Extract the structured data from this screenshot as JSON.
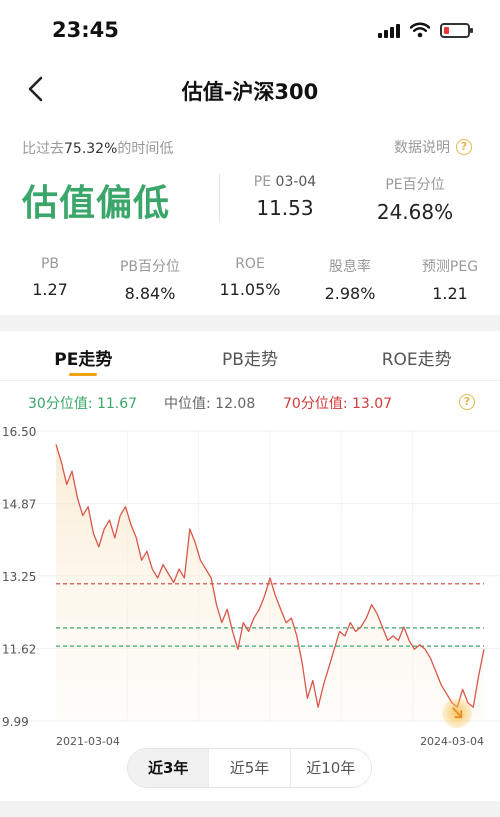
{
  "status_bar": {
    "time": "23:45"
  },
  "nav": {
    "title": "估值-沪深300"
  },
  "summary": {
    "compare_prefix": "比过去",
    "compare_value": "75.32%",
    "compare_suffix": "的时间低",
    "data_explain": "数据说明",
    "valuation_status": "估值偏低",
    "pe_label": "PE",
    "pe_date": "03-04",
    "pe_value": "11.53",
    "pe_pct_label": "PE百分位",
    "pe_pct_value": "24.68%",
    "stats": [
      {
        "label": "PB",
        "value": "1.27"
      },
      {
        "label": "PB百分位",
        "value": "8.84%"
      },
      {
        "label": "ROE",
        "value": "11.05%"
      },
      {
        "label": "股息率",
        "value": "2.98%"
      },
      {
        "label": "预测PEG",
        "value": "1.21"
      }
    ]
  },
  "tabs": [
    "PE走势",
    "PB走势",
    "ROE走势"
  ],
  "active_tab": 0,
  "percentiles": {
    "p30_label": "30分位值:",
    "p30_value": "11.67",
    "median_label": "中位值:",
    "median_value": "12.08",
    "p70_label": "70分位值:",
    "p70_value": "13.07"
  },
  "range_buttons": [
    "近3年",
    "近5年",
    "近10年"
  ],
  "active_range": 0,
  "colors": {
    "accent": "#f2a10f",
    "low_green": "#3aa66a",
    "high_red": "#d23b3b",
    "line": "#d9574a"
  },
  "chart_data": {
    "type": "line",
    "x_start": "2021-03-04",
    "x_end": "2024-03-04",
    "x_tick_labels": [
      "2021-03-04",
      "2024-03-04"
    ],
    "y_tick_labels": [
      "16.50",
      "14.87",
      "13.25",
      "11.62",
      "9.99"
    ],
    "ylim": [
      9.99,
      16.5
    ],
    "reference_lines": [
      {
        "value": 13.07,
        "color": "#d23b3b"
      },
      {
        "value": 12.08,
        "color": "#3aa66a"
      },
      {
        "value": 11.67,
        "color": "#3aa66a"
      }
    ],
    "series": [
      {
        "values": [
          16.2,
          15.8,
          15.3,
          15.6,
          15.0,
          14.6,
          14.8,
          14.2,
          13.9,
          14.3,
          14.5,
          14.1,
          14.6,
          14.8,
          14.4,
          14.1,
          13.6,
          13.8,
          13.4,
          13.2,
          13.5,
          13.3,
          13.1,
          13.4,
          13.2,
          14.3,
          14.0,
          13.6,
          13.4,
          13.2,
          12.6,
          12.2,
          12.5,
          12.0,
          11.6,
          12.2,
          12.0,
          12.3,
          12.5,
          12.8,
          13.2,
          12.8,
          12.5,
          12.2,
          12.3,
          11.9,
          11.3,
          10.5,
          10.9,
          10.3,
          10.8,
          11.2,
          11.6,
          12.0,
          11.9,
          12.2,
          12.0,
          12.1,
          12.3,
          12.6,
          12.4,
          12.1,
          11.8,
          11.9,
          11.8,
          12.1,
          11.8,
          11.6,
          11.7,
          11.6,
          11.4,
          11.1,
          10.8,
          10.6,
          10.4,
          10.3,
          10.7,
          10.4,
          10.3,
          11.0,
          11.6
        ]
      }
    ],
    "last_value": 11.53
  }
}
